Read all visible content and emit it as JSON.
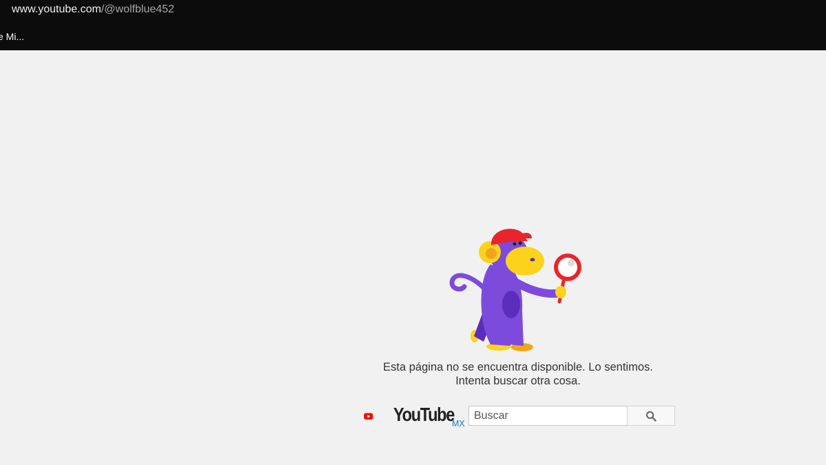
{
  "browser": {
    "url_host": "www.youtube.com",
    "url_path": "/@wolfblue452",
    "tab_label": "e Mi..."
  },
  "error": {
    "illustration": "monkey-with-magnifying-glass",
    "line1": "Esta página no se encuentra disponible. Lo sentimos.",
    "line2": "Intenta buscar otra cosa."
  },
  "logo": {
    "wordmark": "YouTube",
    "country": "MX",
    "brand_color": "#ff0000"
  },
  "search": {
    "placeholder": "Buscar",
    "value": "",
    "button_icon": "search-icon"
  },
  "colors": {
    "topbar": "#0c0c0c",
    "page_background": "#f1f1f1",
    "monkey_body": "#7d4bdc",
    "monkey_face": "#fcd31c",
    "hat_and_magnifier": "#e9252b",
    "country_link": "#167ac6"
  }
}
